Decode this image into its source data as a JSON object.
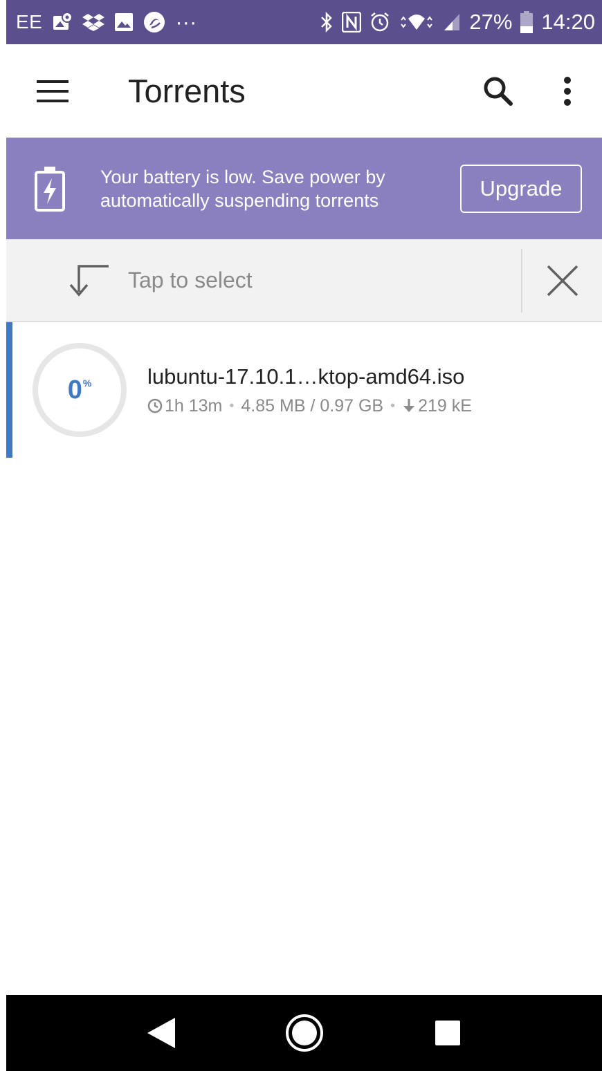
{
  "status_bar": {
    "carrier": "EE",
    "battery_percent": "27%",
    "time": "14:20",
    "overflow": "···",
    "icons": [
      "map-pin-icon",
      "dropbox-icon",
      "image-icon",
      "bittorrent-icon",
      "bluetooth-icon",
      "nfc-icon",
      "alarm-icon",
      "wifi-icon",
      "signal-icon",
      "battery-icon"
    ]
  },
  "app_bar": {
    "title": "Torrents",
    "icons": [
      "menu-icon",
      "search-icon",
      "more-vert-icon"
    ]
  },
  "banner": {
    "message": "Your battery is low. Save power by automatically suspending torrents",
    "button_label": "Upgrade",
    "icon": "battery-charging-icon"
  },
  "select_bar": {
    "hint": "Tap to select",
    "icons": [
      "select-arrow-icon",
      "close-icon"
    ]
  },
  "torrents": [
    {
      "name": "lubuntu-17.10.1…ktop-amd64.iso",
      "progress": "0",
      "progress_unit": "%",
      "progress_fraction": 0,
      "eta": "1h 13m",
      "size": "4.85 MB / 0.97 GB",
      "speed": "219 kE"
    }
  ],
  "nav_bar": {
    "icons": [
      "back-icon",
      "home-icon",
      "recents-icon"
    ]
  },
  "colors": {
    "status_bar": "#5b4f8e",
    "banner": "#8b80bf",
    "accent": "#3f79c2",
    "select_bar": "#f2f2f2",
    "nav_bar": "#000000"
  }
}
